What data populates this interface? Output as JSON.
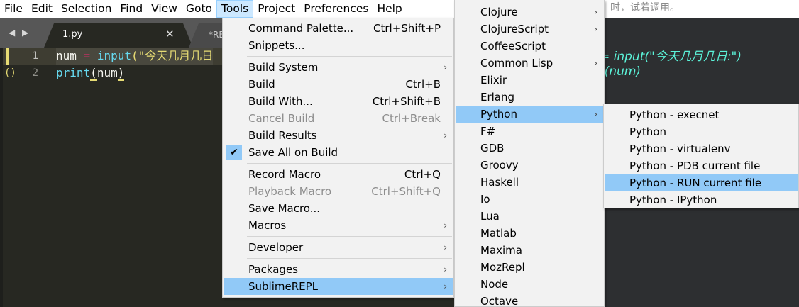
{
  "menubar": {
    "items": [
      "File",
      "Edit",
      "Selection",
      "Find",
      "View",
      "Goto",
      "Tools",
      "Project",
      "Preferences",
      "Help"
    ],
    "active": "Tools"
  },
  "tabs": {
    "nav_glyph": "◀ ▶",
    "active_title": "1.py",
    "active_close": "✕",
    "inactive_title": "*RE"
  },
  "editor": {
    "lines": [
      {
        "number": "1",
        "marker": "",
        "code": {
          "var": "num",
          "op": "=",
          "fn": "input",
          "str": "(\"今天几月几日"
        }
      },
      {
        "number": "2",
        "marker": "()",
        "code": {
          "fn": "print",
          "paren_open": "(",
          "arg": "num",
          "paren_close": ")"
        }
      }
    ]
  },
  "background_window": {
    "top_text": "时，试着调用。",
    "code_line_1": "= input(\"今天几月几日:\")",
    "code_line_2": "t(num)"
  },
  "tools_menu": {
    "items": [
      {
        "label": "Command Palette...",
        "shortcut": "Ctrl+Shift+P"
      },
      {
        "label": "Snippets...",
        "shortcut": ""
      },
      {
        "label": "Build System",
        "submenu": true
      },
      {
        "label": "Build",
        "shortcut": "Ctrl+B"
      },
      {
        "label": "Build With...",
        "shortcut": "Ctrl+Shift+B"
      },
      {
        "label": "Cancel Build",
        "shortcut": "Ctrl+Break",
        "disabled": true
      },
      {
        "label": "Build Results",
        "submenu": true
      },
      {
        "label": "Save All on Build",
        "checked": true
      },
      {
        "label": "Record Macro",
        "shortcut": "Ctrl+Q"
      },
      {
        "label": "Playback Macro",
        "shortcut": "Ctrl+Shift+Q",
        "disabled": true
      },
      {
        "label": "Save Macro..."
      },
      {
        "label": "Macros",
        "submenu": true
      },
      {
        "label": "Developer",
        "submenu": true
      },
      {
        "label": "Packages",
        "submenu": true
      },
      {
        "label": "SublimeREPL",
        "submenu": true,
        "highlighted": true
      }
    ],
    "arrow_glyph": "›",
    "check_glyph": "✔"
  },
  "sublimerepl_menu": {
    "items": [
      {
        "label": "Clojure",
        "submenu": true
      },
      {
        "label": "ClojureScript",
        "submenu": true
      },
      {
        "label": "CoffeeScript"
      },
      {
        "label": "Common Lisp",
        "submenu": true
      },
      {
        "label": "Elixir"
      },
      {
        "label": "Erlang"
      },
      {
        "label": "Python",
        "submenu": true,
        "highlighted": true
      },
      {
        "label": "F#"
      },
      {
        "label": "GDB"
      },
      {
        "label": "Groovy"
      },
      {
        "label": "Haskell"
      },
      {
        "label": "Io"
      },
      {
        "label": "Lua"
      },
      {
        "label": "Matlab"
      },
      {
        "label": "Maxima"
      },
      {
        "label": "MozRepl"
      },
      {
        "label": "Node"
      },
      {
        "label": "Octave"
      }
    ]
  },
  "python_menu": {
    "items": [
      {
        "label": "Python - execnet"
      },
      {
        "label": "Python"
      },
      {
        "label": "Python - virtualenv"
      },
      {
        "label": "Python - PDB current file"
      },
      {
        "label": "Python - RUN current file",
        "highlighted": true
      },
      {
        "label": "Python - IPython"
      }
    ]
  },
  "colors": {
    "menu_highlight": "#91c9f7",
    "editor_bg": "#272822",
    "keyword_fn": "#66d9ef",
    "operator": "#f92672",
    "string": "#e6db74"
  }
}
